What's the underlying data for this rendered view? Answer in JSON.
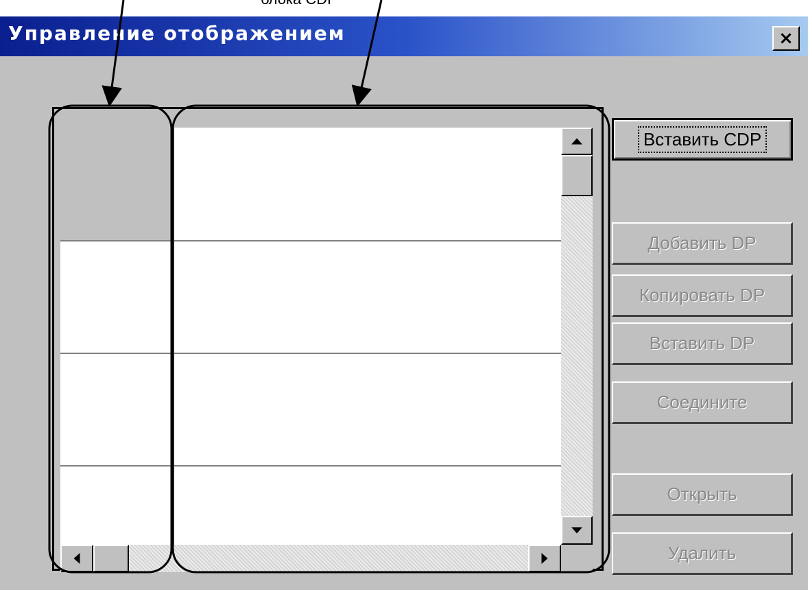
{
  "top_caption": "блока CDP",
  "window": {
    "title": "Управление отображением",
    "close_label": "×"
  },
  "buttons": {
    "insert_cdp": "Вставить CDP",
    "add_dp": "Добавить DP",
    "copy_dp": "Копировать DP",
    "paste_dp": "Вставить DP",
    "connect": "Соедините",
    "open": "Открыть",
    "delete": "Удалить"
  },
  "icons": {
    "close": "close-icon",
    "scroll_up": "arrow-up-icon",
    "scroll_down": "arrow-down-icon",
    "scroll_left": "arrow-left-icon",
    "scroll_right": "arrow-right-icon"
  },
  "colors": {
    "titlebar_start": "#0a1f8f",
    "titlebar_end": "#a6caf0",
    "window_bg": "#c0c0c0",
    "disabled_text": "#8a8a8a"
  }
}
